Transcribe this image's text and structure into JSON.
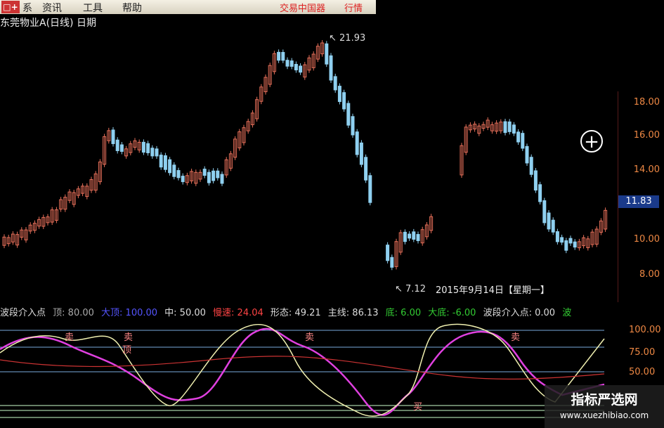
{
  "menu": {
    "items": [
      "资讯",
      "工具",
      "帮助"
    ],
    "first_fragment": "系",
    "right_red_1": "交易中国器",
    "right_red_2": "行情"
  },
  "title": "东莞物业A(日线) 日期",
  "price_axis": [
    "18.00",
    "16.00",
    "14.00",
    "10.00",
    "8.00"
  ],
  "current_price": "11.83",
  "annotations": {
    "high": "21.93",
    "low": "7.12"
  },
  "date_label": "2015年9月14日【星期一】",
  "indicator": {
    "name": "波段介入点",
    "top": "顶: 80.00",
    "big_top": "大顶: 100.00",
    "mid": "中: 50.00",
    "speed": "慢速: 24.04",
    "shape": "形态: 49.21",
    "main": "主线: 86.13",
    "bottom": "底: 6.00",
    "big_bottom": "大底: -6.00",
    "entry": "波段介入点: 0.00",
    "tail": "波"
  },
  "indicator_axis": [
    "100.00",
    "75.00",
    "50.00"
  ],
  "signals": {
    "sell": "卖",
    "buy": "买",
    "top_sig": "顶"
  },
  "watermark": {
    "line1": "指标严选网",
    "line2": "www.xuezhibiao.com"
  },
  "colors": {
    "up": "#e8705a",
    "down": "#8fd0f0",
    "magenta": "#e040e0",
    "yellow": "#f0f0b0"
  }
}
